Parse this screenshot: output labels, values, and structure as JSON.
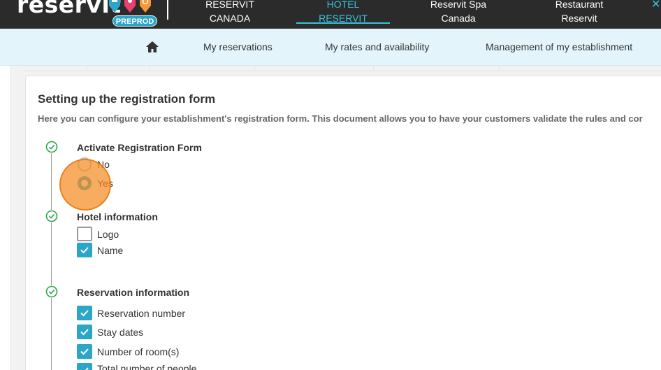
{
  "header": {
    "logo_text": "reservit",
    "environment_badge": "PREPROD",
    "property_tabs": [
      {
        "label": "RESERVIT\nCANADA",
        "active": false
      },
      {
        "label": "HOTEL\nRESERVIT",
        "active": true
      },
      {
        "label": "Reservit Spa\nCanada",
        "active": false
      },
      {
        "label": "Restaurant\nReservit",
        "active": false
      }
    ],
    "close_icon": "close-icon",
    "accent_color": "#36c4dc",
    "background_color": "#2b2b2b"
  },
  "subnav": {
    "home_icon": "home-icon",
    "items": [
      {
        "label": "My reservations"
      },
      {
        "label": "My rates and availability"
      },
      {
        "label": "Management of my establishment"
      }
    ]
  },
  "form": {
    "title": "Setting up the registration form",
    "description": "Here you can configure your establishment's registration form. This document allows you to have your customers validate the rules and cor",
    "sections": [
      {
        "title": "Activate Registration Form",
        "status_icon": "check-circle-icon",
        "type": "radio",
        "options": [
          {
            "label": "No",
            "checked": false
          },
          {
            "label": "Yes",
            "checked": true
          }
        ]
      },
      {
        "title": "Hotel information",
        "status_icon": "check-circle-icon",
        "type": "checkbox",
        "options": [
          {
            "label": "Logo",
            "checked": false
          },
          {
            "label": "Name",
            "checked": true
          }
        ]
      },
      {
        "title": "Reservation information",
        "status_icon": "check-circle-icon",
        "type": "checkbox",
        "options": [
          {
            "label": "Reservation number",
            "checked": true
          },
          {
            "label": "Stay dates",
            "checked": true
          },
          {
            "label": "Number of room(s)",
            "checked": true
          },
          {
            "label": "Total number of people",
            "checked": true
          }
        ]
      }
    ]
  },
  "colors": {
    "primary": "#2ba6c8",
    "success": "#2ea44f",
    "subnav_bg": "#e3f5fa"
  }
}
